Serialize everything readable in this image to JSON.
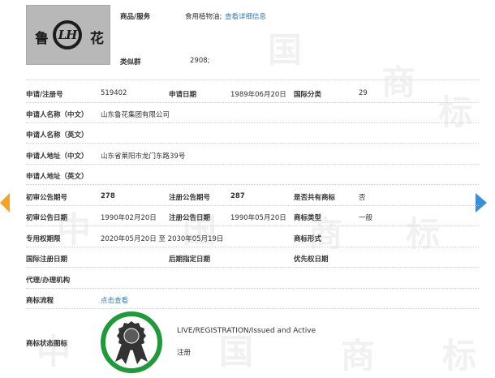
{
  "watermark_chars": [
    "中",
    "国",
    "商",
    "标"
  ],
  "trademark_image": {
    "left_char": "鲁",
    "center_letters": "LH",
    "right_char": "花"
  },
  "goods_services": {
    "label": "商品/服务",
    "value": "食用植物油;",
    "link": "查看详细信息"
  },
  "similar_group": {
    "label": "类似群",
    "value": "2908;"
  },
  "rows": {
    "reg_no_label": "申请/注册号",
    "reg_no": "519402",
    "app_date_label": "申请日期",
    "app_date": "1989年06月20日",
    "intl_class_label": "国际分类",
    "intl_class": "29",
    "applicant_cn_label": "申请人名称（中文）",
    "applicant_cn": "山东鲁花集团有限公司",
    "applicant_en_label": "申请人名称（英文）",
    "address_cn_label": "申请人地址（中文）",
    "address_cn": "山东省莱阳市龙门东路39号",
    "address_en_label": "申请人地址（英文）",
    "prelim_issue_label": "初审公告期号",
    "prelim_issue": "278",
    "reg_issue_label": "注册公告期号",
    "reg_issue": "287",
    "shared_label": "是否共有商标",
    "shared": "否",
    "prelim_date_label": "初审公告日期",
    "prelim_date": "1990年02月20日",
    "reg_date_label": "注册公告日期",
    "reg_date": "1990年05月20日",
    "tm_type_label": "商标类型",
    "tm_type": "一般",
    "exclusive_label": "专用权期限",
    "exclusive": "2020年05月20日 至 2030年05月19日",
    "tm_form_label": "商标形式",
    "intl_reg_date_label": "国际注册日期",
    "later_date_label": "后期指定日期",
    "priority_date_label": "优先权日期",
    "agent_label": "代理/办理机构",
    "process_label": "商标流程",
    "process_link": "点击查看",
    "status_icon_label": "商标状态图标",
    "status_en": "LIVE/REGISTRATION/Issued and Active",
    "status_cn": "注册"
  },
  "colors": {
    "link": "#2f7cc1",
    "status_green": "#1f9a3a",
    "arrow_left": "#f1a22a",
    "arrow_right": "#3a8fd8"
  }
}
